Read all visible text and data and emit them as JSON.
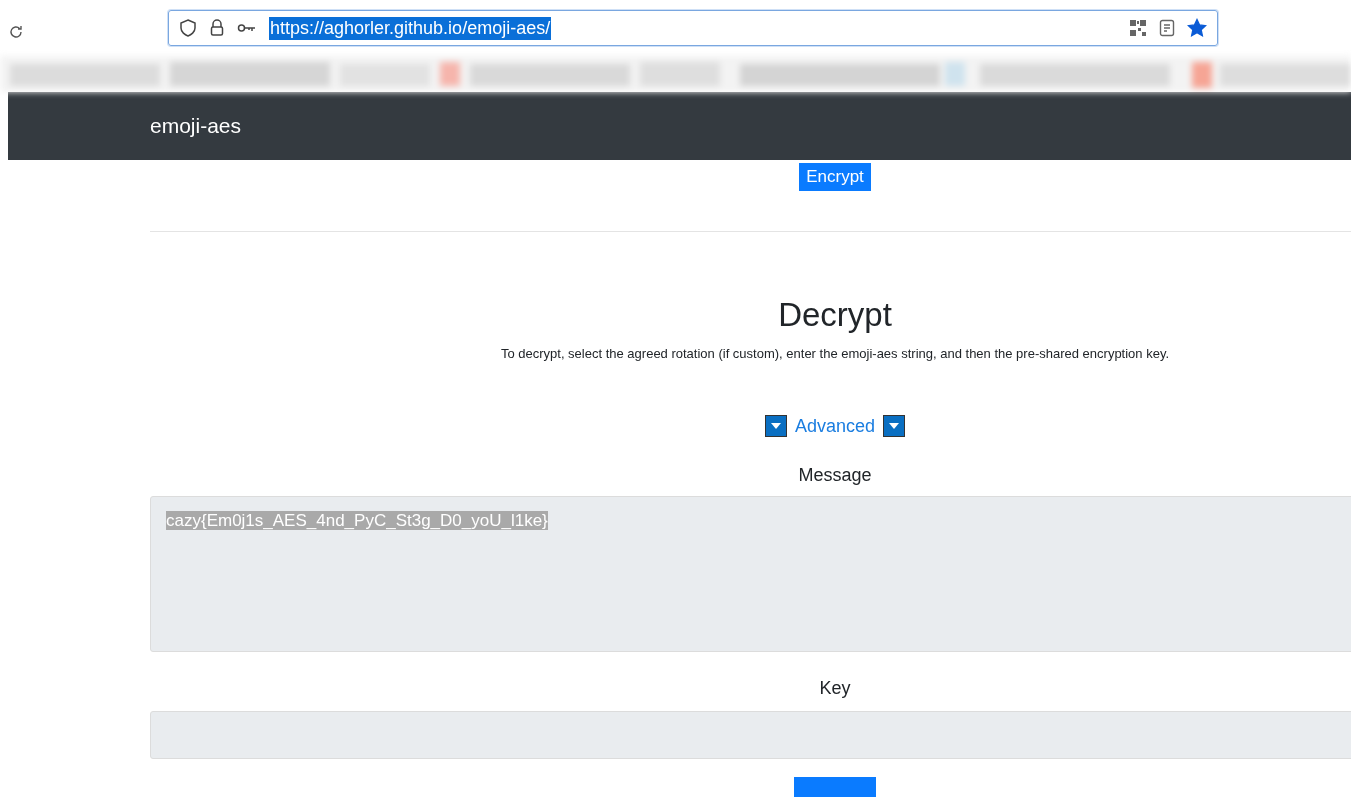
{
  "browser": {
    "url": "https://aghorler.github.io/emoji-aes/",
    "url_selected": true,
    "bookmarked": true
  },
  "navbar": {
    "brand": "emoji-aes"
  },
  "encrypt_button": "Encrypt",
  "decrypt": {
    "title": "Decrypt",
    "description": "To decrypt, select the agreed rotation (if custom), enter the emoji-aes string, and then the pre-shared encryption key.",
    "advanced": {
      "label": "Advanced",
      "expanded": false
    },
    "message_label": "Message",
    "message": {
      "value": "cazy{Em0j1s_AES_4nd_PyC_St3g_D0_yoU_l1ke}",
      "selected": true
    },
    "key_label": "Key"
  }
}
